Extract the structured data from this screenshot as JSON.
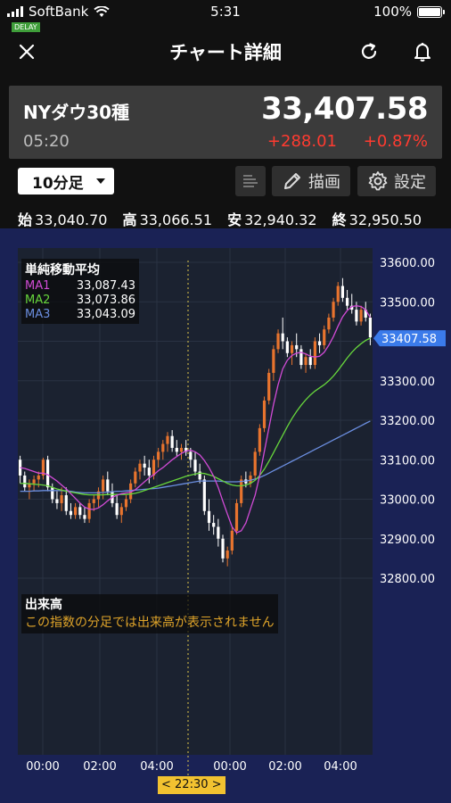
{
  "status": {
    "carrier": "SoftBank",
    "time": "5:31",
    "battery": "100%",
    "delay": "DELAY"
  },
  "nav": {
    "title": "チャート詳細"
  },
  "quote": {
    "name": "NYダウ30種",
    "price": "33,407.58",
    "time": "05:20",
    "change": "+288.01",
    "change_pct": "+0.87%"
  },
  "toolbar": {
    "period": "10分足",
    "draw_label": "描画",
    "settings_label": "設定"
  },
  "ohlc": {
    "open_label": "始",
    "open": "33,040.70",
    "high_label": "高",
    "high": "33,066.51",
    "low_label": "安",
    "low": "32,940.32",
    "close_label": "終",
    "close": "32,950.50"
  },
  "ma": {
    "title": "単純移動平均",
    "lines": [
      {
        "name": "MA1",
        "value": "33,087.43",
        "color": "#d14bd6"
      },
      {
        "name": "MA2",
        "value": "33,073.86",
        "color": "#67d63c"
      },
      {
        "name": "MA3",
        "value": "33,043.09",
        "color": "#6b8ee0"
      }
    ]
  },
  "volume": {
    "title": "出来高",
    "message": "この指数の分足では出来高が表示されません"
  },
  "crosshair": {
    "label": "< 22:30 >"
  },
  "colors": {
    "up": "#e8742e",
    "down": "#ffffff",
    "last_price_badge": "#3b7bea",
    "crosshair": "#e0c84a"
  },
  "chart_data": {
    "type": "candlestick",
    "ylim": [
      32800,
      33600
    ],
    "ytick_labels": [
      "33600.00",
      "33500.00",
      "33400.00",
      "33300.00",
      "33200.00",
      "33100.00",
      "33000.00",
      "32900.00",
      "32800.00"
    ],
    "yticks": [
      33600,
      33500,
      33400,
      33300,
      33200,
      33100,
      33000,
      32900,
      32800
    ],
    "xtick_labels": [
      "00:00",
      "02:00",
      "04:00",
      "00:00",
      "02:00",
      "04:00"
    ],
    "last_price": 33407.58,
    "last_price_label": "33407.58",
    "candles": [
      [
        33100,
        33110,
        33040,
        33060
      ],
      [
        33060,
        33070,
        33020,
        33030
      ],
      [
        33030,
        33050,
        33000,
        33040
      ],
      [
        33040,
        33060,
        33020,
        33050
      ],
      [
        33050,
        33070,
        33030,
        33060
      ],
      [
        33060,
        33105,
        33050,
        33100
      ],
      [
        33100,
        33110,
        33020,
        33030
      ],
      [
        33030,
        33040,
        32990,
        33000
      ],
      [
        33000,
        33020,
        32975,
        32990
      ],
      [
        32990,
        33030,
        32970,
        33010
      ],
      [
        33010,
        33030,
        32960,
        32970
      ],
      [
        32970,
        32990,
        32950,
        32960
      ],
      [
        32960,
        32990,
        32950,
        32980
      ],
      [
        32980,
        32990,
        32950,
        32960
      ],
      [
        32960,
        32980,
        32940,
        32950
      ],
      [
        32950,
        33000,
        32940,
        32990
      ],
      [
        32990,
        33010,
        32970,
        33000
      ],
      [
        33000,
        33030,
        32980,
        33020
      ],
      [
        33020,
        33060,
        33000,
        33050
      ],
      [
        33050,
        33070,
        33010,
        33020
      ],
      [
        33020,
        33040,
        32980,
        32990
      ],
      [
        32990,
        33010,
        32950,
        32960
      ],
      [
        32960,
        32990,
        32940,
        32980
      ],
      [
        32980,
        33010,
        32970,
        33000
      ],
      [
        33000,
        33050,
        32990,
        33040
      ],
      [
        33040,
        33080,
        33030,
        33070
      ],
      [
        33070,
        33100,
        33050,
        33090
      ],
      [
        33090,
        33110,
        33060,
        33080
      ],
      [
        33080,
        33100,
        33040,
        33060
      ],
      [
        33060,
        33110,
        33050,
        33100
      ],
      [
        33100,
        33130,
        33080,
        33120
      ],
      [
        33120,
        33150,
        33100,
        33140
      ],
      [
        33140,
        33170,
        33120,
        33160
      ],
      [
        33160,
        33175,
        33120,
        33130
      ],
      [
        33130,
        33150,
        33110,
        33120
      ],
      [
        33120,
        33140,
        33100,
        33130
      ],
      [
        33130,
        33150,
        33110,
        33120
      ],
      [
        33120,
        33130,
        33080,
        33100
      ],
      [
        33100,
        33120,
        33060,
        33070
      ],
      [
        33070,
        33090,
        33040,
        33050
      ],
      [
        33050,
        33060,
        32960,
        32970
      ],
      [
        32970,
        33000,
        32920,
        32940
      ],
      [
        32940,
        32960,
        32910,
        32930
      ],
      [
        32930,
        32950,
        32880,
        32900
      ],
      [
        32900,
        32910,
        32840,
        32850
      ],
      [
        32850,
        32880,
        32830,
        32870
      ],
      [
        32870,
        32930,
        32860,
        32920
      ],
      [
        32920,
        33000,
        32910,
        32990
      ],
      [
        32990,
        33060,
        32980,
        33050
      ],
      [
        33050,
        33070,
        33030,
        33040
      ],
      [
        33040,
        33070,
        33030,
        33060
      ],
      [
        33060,
        33130,
        33050,
        33120
      ],
      [
        33120,
        33190,
        33110,
        33180
      ],
      [
        33180,
        33260,
        33170,
        33250
      ],
      [
        33250,
        33330,
        33240,
        33320
      ],
      [
        33320,
        33390,
        33300,
        33380
      ],
      [
        33380,
        33430,
        33370,
        33420
      ],
      [
        33420,
        33460,
        33380,
        33400
      ],
      [
        33400,
        33410,
        33360,
        33370
      ],
      [
        33370,
        33400,
        33340,
        33390
      ],
      [
        33390,
        33420,
        33360,
        33380
      ],
      [
        33380,
        33390,
        33330,
        33340
      ],
      [
        33340,
        33370,
        33320,
        33360
      ],
      [
        33360,
        33380,
        33330,
        33340
      ],
      [
        33340,
        33410,
        33330,
        33400
      ],
      [
        33400,
        33420,
        33370,
        33390
      ],
      [
        33390,
        33440,
        33380,
        33430
      ],
      [
        33430,
        33470,
        33420,
        33460
      ],
      [
        33460,
        33510,
        33450,
        33500
      ],
      [
        33500,
        33550,
        33490,
        33540
      ],
      [
        33540,
        33560,
        33500,
        33510
      ],
      [
        33510,
        33530,
        33480,
        33490
      ],
      [
        33490,
        33520,
        33470,
        33480
      ],
      [
        33480,
        33500,
        33440,
        33450
      ],
      [
        33450,
        33490,
        33440,
        33480
      ],
      [
        33480,
        33500,
        33450,
        33460
      ],
      [
        33460,
        33470,
        33390,
        33410
      ]
    ],
    "ma1": [
      33080,
      33078,
      33074,
      33070,
      33066,
      33066,
      33062,
      33054,
      33046,
      33036,
      33026,
      33014,
      33002,
      32990,
      32980,
      32975,
      32974,
      32978,
      32986,
      32996,
      33005,
      33010,
      33014,
      33016,
      33018,
      33024,
      33034,
      33044,
      33054,
      33062,
      33072,
      33080,
      33090,
      33100,
      33108,
      33116,
      33122,
      33124,
      33120,
      33112,
      33098,
      33080,
      33058,
      33030,
      32995,
      32962,
      32930,
      32915,
      32920,
      32940,
      32975,
      33010,
      33060,
      33120,
      33180,
      33240,
      33290,
      33330,
      33352,
      33364,
      33370,
      33372,
      33368,
      33362,
      33360,
      33362,
      33372,
      33390,
      33412,
      33438,
      33462,
      33478,
      33488,
      33490,
      33488,
      33480,
      33460
    ],
    "ma2": [
      33040,
      33040,
      33039,
      33038,
      33037,
      33036,
      33034,
      33030,
      33026,
      33023,
      33020,
      33018,
      33016,
      33014,
      33012,
      33011,
      33011,
      33011,
      33011,
      33012,
      33012,
      33012,
      33012,
      33012,
      33013,
      33015,
      33018,
      33022,
      33026,
      33030,
      33034,
      33038,
      33042,
      33046,
      33050,
      33054,
      33058,
      33061,
      33064,
      33066,
      33065,
      33062,
      33058,
      33052,
      33046,
      33040,
      33036,
      33034,
      33034,
      33036,
      33040,
      33048,
      33060,
      33076,
      33096,
      33118,
      33140,
      33162,
      33184,
      33204,
      33222,
      33238,
      33252,
      33264,
      33274,
      33282,
      33290,
      33300,
      33312,
      33326,
      33342,
      33358,
      33372,
      33384,
      33394,
      33402,
      33408
    ],
    "ma3": [
      33020,
      33020,
      33020,
      33021,
      33021,
      33022,
      33022,
      33022,
      33022,
      33022,
      33021,
      33020,
      33018,
      33017,
      33016,
      33016,
      33016,
      33016,
      33017,
      33018,
      33019,
      33020,
      33020,
      33021,
      33022,
      33023,
      33024,
      33025,
      33026,
      33027,
      33028,
      33030,
      33032,
      33034,
      33036,
      33038,
      33040,
      33042,
      33044,
      33046,
      33046,
      33046,
      33046,
      33046,
      33045,
      33044,
      33044,
      33044,
      33045,
      33046,
      33048,
      33051,
      33055,
      33060,
      33066,
      33072,
      33078,
      33084,
      33090,
      33096,
      33102,
      33108,
      33114,
      33120,
      33126,
      33132,
      33138,
      33144,
      33150,
      33156,
      33162,
      33168,
      33174,
      33180,
      33186,
      33192,
      33198
    ]
  }
}
